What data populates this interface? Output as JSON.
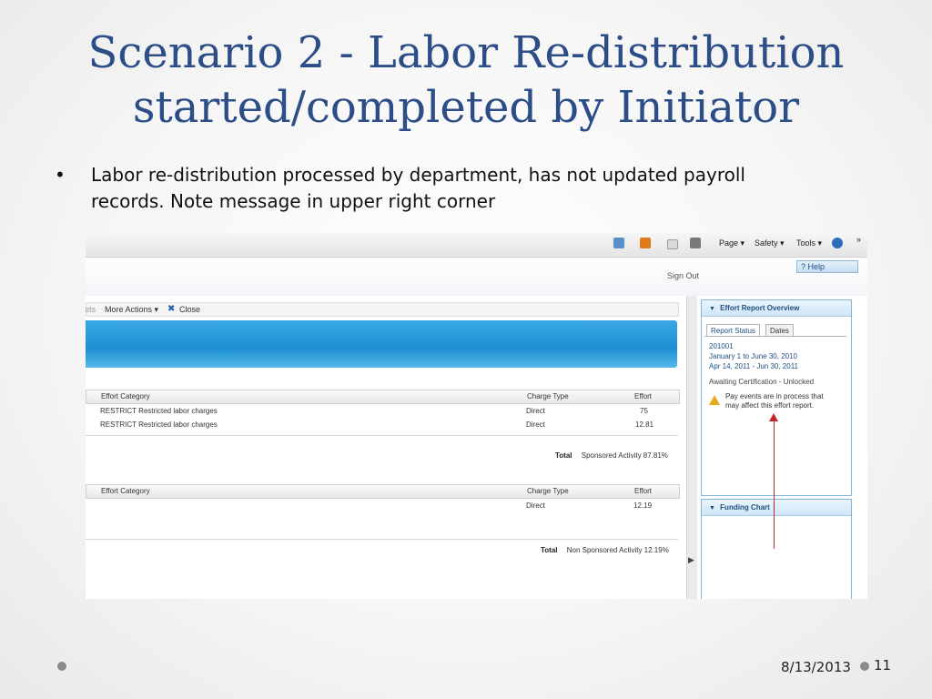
{
  "slide": {
    "title_line1": "Scenario 2 - Labor Re-distribution",
    "title_line2": "started/completed by Initiator",
    "bullet_char": "•",
    "bullet_text": "Labor re-distribution processed by department, has not updated payroll records. Note message in upper right corner",
    "date": "8/13/2013",
    "page_number": "11"
  },
  "browser_toolbar": {
    "items": [
      "Page ▾",
      "Safety ▾",
      "Tools ▾"
    ],
    "more": "»"
  },
  "app_header": {
    "help_label": "? Help",
    "signout_label": "Sign Out"
  },
  "action_bar": {
    "cut_left": "ets",
    "more_actions": "More Actions ▾",
    "close_icon": "✖",
    "close": "Close"
  },
  "sponsored_table": {
    "headers": [
      "Effort Category",
      "Charge Type",
      "Effort"
    ],
    "rows": [
      {
        "category": "RESTRICT Restricted labor charges",
        "charge_type": "Direct",
        "effort": "75"
      },
      {
        "category": "RESTRICT Restricted labor charges",
        "charge_type": "Direct",
        "effort": "12.81"
      }
    ],
    "total_label": "Total",
    "total_value": "Sponsored Activity 87.81%"
  },
  "nonsponsored_table": {
    "headers": [
      "Effort Category",
      "Charge Type",
      "Effort"
    ],
    "rows": [
      {
        "category": "",
        "charge_type": "Direct",
        "effort": "12.19"
      }
    ],
    "total_label": "Total",
    "total_value": "Non Sponsored Activity 12.19%"
  },
  "effort_panel": {
    "title": "Effort Report Overview",
    "tabs": [
      "Report Status",
      "Dates"
    ],
    "report_id": "201001",
    "period": "January 1 to June 30, 2010",
    "dates": "Apr 14, 2011 - Jun 30, 2011",
    "status": "Awaiting Certification - Unlocked",
    "warning_line1": "Pay events are in process that",
    "warning_line2": "may affect this effort report."
  },
  "funding_panel": {
    "title": "Funding Chart"
  },
  "colors": {
    "title": "#2c4d87",
    "link_blue": "#1d4f86",
    "banner": "#1d8fd3",
    "warning": "#e8a91a",
    "annotation_arrow": "#c0272d"
  }
}
